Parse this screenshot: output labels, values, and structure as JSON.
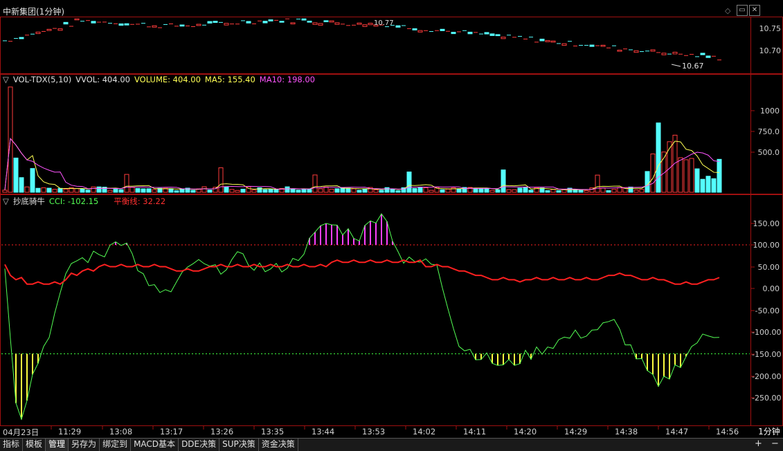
{
  "window": {
    "title": "中新集团(1分钟)"
  },
  "price_pane": {
    "axis_labels": [
      "10.75",
      "10.70"
    ],
    "peak_annotation": "10.77",
    "low_annotation": "10.67"
  },
  "volume_pane": {
    "indicator_name": "VOL-TDX(5,10)",
    "vvol": "VVOL: 404.00",
    "volume": "VOLUME: 404.00",
    "ma5": "MA5: 155.40",
    "ma10": "MA10: 198.00",
    "axis_labels": [
      "1000",
      "750.0",
      "500.0"
    ]
  },
  "cci_pane": {
    "indicator_name": "抄底骑牛",
    "cci": "CCI: -102.15",
    "balance": "平衡线: 32.22",
    "axis_labels": [
      "150.00",
      "100.00",
      "50.00",
      "0.00",
      "-50.00",
      "-100.00",
      "-150.00",
      "-200.00",
      "-250.00"
    ]
  },
  "time_axis": [
    "04月23日",
    "11:29",
    "13:08",
    "13:17",
    "13:26",
    "13:35",
    "13:44",
    "13:53",
    "14:02",
    "14:11",
    "14:20",
    "14:29",
    "14:38",
    "14:47",
    "14:56"
  ],
  "period": "1分钟",
  "bottom_tabs": [
    "指标",
    "模板",
    "管理",
    "另存为",
    "绑定到",
    "MACD基本",
    "DDE决策",
    "SUP决策",
    "资金决策"
  ],
  "active_tab": "管理",
  "zoom_buttons": [
    "+",
    "−"
  ],
  "colors": {
    "up": "#ff3c3c",
    "down": "#54ffff",
    "ma5": "#ffff54",
    "ma10": "#ff54ff",
    "cci_line": "#54ff54",
    "balance_line": "#ff2020",
    "border": "#a01010"
  },
  "chart_data": [
    {
      "type": "candlestick",
      "ylim": [
        10.66,
        10.78
      ],
      "description_values": {
        "high": 10.77,
        "low": 10.67
      }
    },
    {
      "type": "bar",
      "series": [
        {
          "name": "VOLUME",
          "last": 404.0
        },
        {
          "name": "MA5",
          "last": 155.4
        },
        {
          "name": "MA10",
          "last": 198.0
        }
      ],
      "ylim": [
        0,
        1250
      ]
    },
    {
      "type": "line",
      "series": [
        {
          "name": "CCI",
          "last": -102.15
        },
        {
          "name": "平衡线",
          "last": 32.22
        }
      ],
      "ylim": [
        -300,
        200
      ]
    }
  ]
}
